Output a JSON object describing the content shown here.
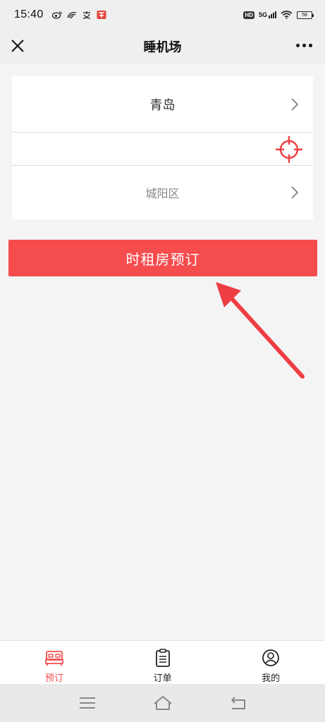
{
  "status_bar": {
    "time": "15:40",
    "hd_badge": "HD",
    "network": "5G",
    "battery": "58"
  },
  "nav": {
    "title": "睡机场"
  },
  "form": {
    "city": "青岛",
    "district": "城阳区"
  },
  "booking_button": {
    "label": "时租房预订"
  },
  "tabs": [
    {
      "label": "预订",
      "icon": "bed-icon",
      "active": true
    },
    {
      "label": "订单",
      "icon": "clipboard-icon",
      "active": false
    },
    {
      "label": "我的",
      "icon": "user-icon",
      "active": false
    }
  ],
  "colors": {
    "accent": "#f54c4e",
    "annotation": "#ee3e43"
  }
}
